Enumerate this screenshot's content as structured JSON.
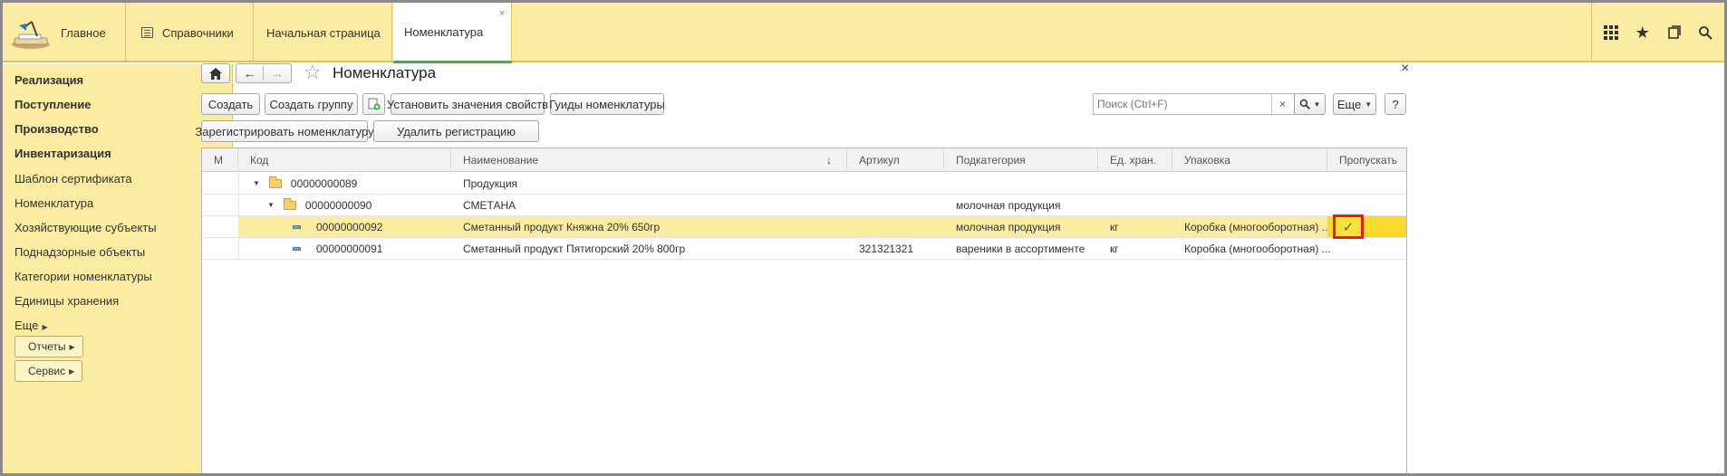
{
  "topbar": {
    "home_label": "Главное",
    "reference_label": "Справочники",
    "tabs": [
      {
        "label": "Начальная страница"
      },
      {
        "label": "Номенклатура",
        "close": "×"
      }
    ],
    "icons": [
      "apps-grid-icon",
      "star-icon",
      "history-icon",
      "search-icon"
    ]
  },
  "sidebar": {
    "bold_items": [
      "Реализация",
      "Поступление",
      "Производство",
      "Инвентаризация"
    ],
    "items": [
      "Шаблон сертификата",
      "Номенклатура",
      "Хозяйствующие субъекты",
      "Поднадзорные объекты",
      "Категории номенклатуры",
      "Единицы хранения",
      "Еще"
    ],
    "buttons": [
      "Отчеты",
      "Сервис"
    ]
  },
  "form": {
    "title": "Номенклатура",
    "close": "×",
    "buttons": {
      "create": "Создать",
      "create_group": "Создать группу",
      "set_props": "Установить значения свойств",
      "guids": "Гуиды номенклатуры",
      "register": "Зарегистрировать номенклатуру",
      "unregister": "Удалить регистрацию",
      "more": "Еще",
      "help": "?"
    },
    "search": {
      "placeholder": "Поиск (Ctrl+F)",
      "clear": "×"
    }
  },
  "table": {
    "columns": [
      "М",
      "Код",
      "Наименование",
      "Артикул",
      "Подкатегория",
      "Ед. хран.",
      "Упаковка",
      "Пропускать"
    ],
    "sort_indicator": "↓",
    "rows": [
      {
        "code": "00000000089",
        "name": "Продукция",
        "article": "",
        "subcategory": "",
        "unit": "",
        "package": "",
        "skip": ""
      },
      {
        "code": "00000000090",
        "name": "СМЕТАНА",
        "article": "",
        "subcategory": "молочная продукция",
        "unit": "",
        "package": "",
        "skip": ""
      },
      {
        "code": "00000000092",
        "name": "Сметанный продукт Княжна 20% 650гр",
        "article": "",
        "subcategory": "молочная продукция",
        "unit": "кг",
        "package": "Коробка (многооборотная) ...",
        "skip": "✓"
      },
      {
        "code": "00000000091",
        "name": "Сметанный продукт Пятигорский 20% 800гр",
        "article": "321321321",
        "subcategory": "вареники в ассортименте",
        "unit": "кг",
        "package": "Коробка (многооборотная) ...",
        "skip": ""
      }
    ]
  }
}
